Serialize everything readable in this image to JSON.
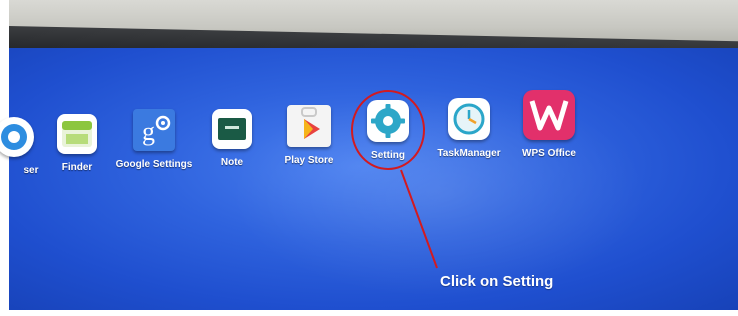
{
  "apps": [
    {
      "label": "ser",
      "icon": "browser-icon"
    },
    {
      "label": "Finder",
      "icon": "finder-icon"
    },
    {
      "label": "Google Settings",
      "icon": "google-settings-icon"
    },
    {
      "label": "Note",
      "icon": "note-icon"
    },
    {
      "label": "Play Store",
      "icon": "play-store-icon"
    },
    {
      "label": "Setting",
      "icon": "gear-icon"
    },
    {
      "label": "TaskManager",
      "icon": "task-manager-icon"
    },
    {
      "label": "WPS Office",
      "icon": "wps-office-icon"
    }
  ],
  "annotation": {
    "text": "Click on Setting",
    "color": "#d21a20"
  },
  "colors": {
    "screen": "#2f63de",
    "callout_text": "#ffffff"
  }
}
